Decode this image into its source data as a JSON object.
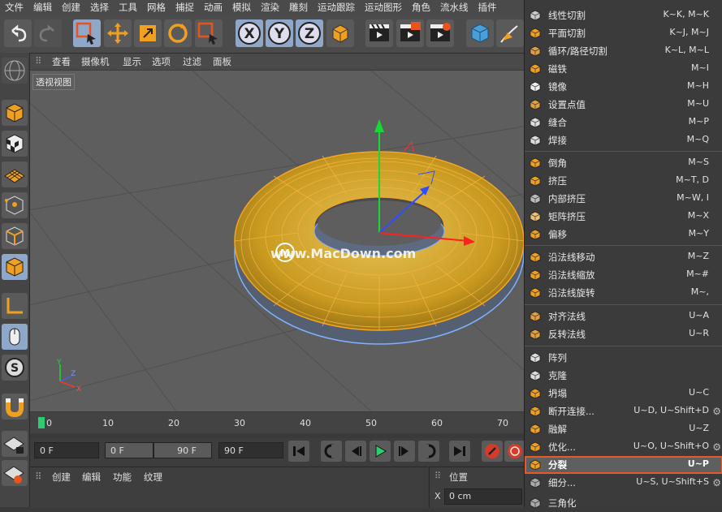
{
  "menubar": [
    "文件",
    "编辑",
    "创建",
    "选择",
    "工具",
    "网格",
    "捕捉",
    "动画",
    "模拟",
    "渲染",
    "雕刻",
    "运动跟踪",
    "运动图形",
    "角色",
    "流水线",
    "插件"
  ],
  "viewport_menu": [
    "查看",
    "摄像机",
    "显示",
    "选项",
    "过滤",
    "面板"
  ],
  "viewport_label": "透视视图",
  "watermark": "www.MacDown.com",
  "axis_labels": {
    "y": "Y",
    "z": "Z",
    "x": "X"
  },
  "timeline_ticks": [
    "0",
    "10",
    "20",
    "30",
    "40",
    "50",
    "60",
    "70"
  ],
  "transport": {
    "current_frame": "0 F",
    "range_start": "0 F",
    "range_end": "90 F",
    "end_frame": "90 F"
  },
  "material_menu": [
    "创建",
    "编辑",
    "功能",
    "纹理"
  ],
  "attr_panel": {
    "title": "位置",
    "x_label": "X",
    "x_value": "0 cm"
  },
  "context_menu": [
    {
      "label": "线性切割",
      "shortcut": "K~K, M~K",
      "icon": "knife-icon"
    },
    {
      "label": "平面切割",
      "shortcut": "K~J, M~J",
      "icon": "plane-cut-icon"
    },
    {
      "label": "循环/路径切割",
      "shortcut": "K~L, M~L",
      "icon": "loop-cut-icon"
    },
    {
      "label": "磁铁",
      "shortcut": "M~I",
      "icon": "magnet-icon"
    },
    {
      "label": "镜像",
      "shortcut": "M~H",
      "icon": "mirror-icon"
    },
    {
      "label": "设置点值",
      "shortcut": "M~U",
      "icon": "set-point-icon"
    },
    {
      "label": "缝合",
      "shortcut": "M~P",
      "icon": "stitch-icon"
    },
    {
      "label": "焊接",
      "shortcut": "M~Q",
      "icon": "weld-icon"
    },
    {
      "label": "倒角",
      "shortcut": "M~S",
      "icon": "bevel-icon"
    },
    {
      "label": "挤压",
      "shortcut": "M~T, D",
      "icon": "extrude-icon"
    },
    {
      "label": "内部挤压",
      "shortcut": "M~W, I",
      "icon": "inner-extrude-icon"
    },
    {
      "label": "矩阵挤压",
      "shortcut": "M~X",
      "icon": "matrix-extrude-icon"
    },
    {
      "label": "偏移",
      "shortcut": "M~Y",
      "icon": "offset-icon"
    },
    {
      "label": "沿法线移动",
      "shortcut": "M~Z",
      "icon": "normal-move-icon"
    },
    {
      "label": "沿法线缩放",
      "shortcut": "M~#",
      "icon": "normal-scale-icon"
    },
    {
      "label": "沿法线旋转",
      "shortcut": "M~,",
      "icon": "normal-rotate-icon"
    },
    {
      "label": "对齐法线",
      "shortcut": "U~A",
      "icon": "align-normals-icon"
    },
    {
      "label": "反转法线",
      "shortcut": "U~R",
      "icon": "reverse-normals-icon"
    },
    {
      "label": "阵列",
      "shortcut": "",
      "icon": "array-icon"
    },
    {
      "label": "克隆",
      "shortcut": "",
      "icon": "clone-icon"
    },
    {
      "label": "坍塌",
      "shortcut": "U~C",
      "icon": "collapse-icon"
    },
    {
      "label": "断开连接...",
      "shortcut": "U~D, U~Shift+D",
      "icon": "disconnect-icon"
    },
    {
      "label": "融解",
      "shortcut": "U~Z",
      "icon": "melt-icon"
    },
    {
      "label": "优化...",
      "shortcut": "U~O, U~Shift+O",
      "icon": "optimize-icon"
    },
    {
      "label": "分裂",
      "shortcut": "U~P",
      "icon": "split-icon"
    },
    {
      "label": "细分...",
      "shortcut": "U~S, U~Shift+S",
      "icon": "subdivide-icon"
    },
    {
      "label": "三角化",
      "shortcut": "",
      "icon": "triangulate-icon"
    }
  ]
}
